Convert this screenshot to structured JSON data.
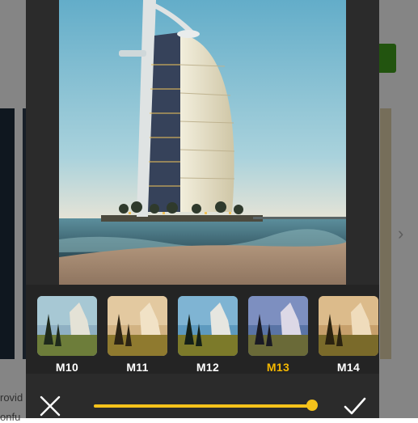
{
  "background_page": {
    "text_fragment_1": "rovid",
    "text_fragment_2": "onfu",
    "accent_color": "#3f9a1c"
  },
  "editor": {
    "filters": [
      {
        "label": "M10",
        "active": false
      },
      {
        "label": "M11",
        "active": false
      },
      {
        "label": "M12",
        "active": false
      },
      {
        "label": "M13",
        "active": true
      },
      {
        "label": "M14",
        "active": false
      }
    ],
    "intensity": 1.0,
    "accent_color": "#f5c21b",
    "active_label_color": "#f5b800",
    "cancel_icon": "close-icon",
    "confirm_icon": "check-icon"
  }
}
